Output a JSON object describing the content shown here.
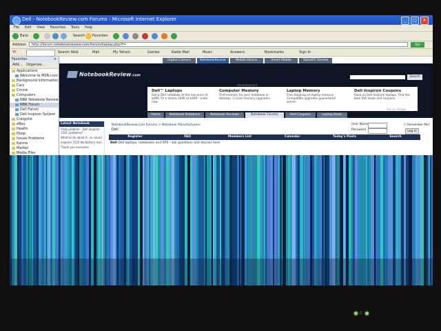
{
  "window": {
    "title": "Dell - NotebookReview.com Forums - Microsoft Internet Explorer",
    "buttons": [
      "_",
      "□",
      "×"
    ]
  },
  "menu": [
    "File",
    "Edit",
    "View",
    "Favorites",
    "Tools",
    "Help"
  ],
  "toolbar": {
    "back": "Back",
    "search": "Search",
    "favorites": "Favorites"
  },
  "address": {
    "label": "Address",
    "url": "http://forum.notebookreview.com/forumdisplay.php?f=",
    "go": "Go"
  },
  "links": [
    "Search Web",
    "Mail",
    "My Yahoo!",
    "Games",
    "Radio Mail",
    "Music",
    "Answers",
    "Bookmarks",
    "Sign In"
  ],
  "sidebar": {
    "title": "Favorites",
    "add": "Add...",
    "organize": "Organize...",
    "items": [
      {
        "label": "Applications",
        "type": "folder"
      },
      {
        "label": "Welcome to MSN.com - Windows",
        "type": "page"
      },
      {
        "label": "Background Information",
        "type": "folder"
      },
      {
        "label": "Cars",
        "type": "folder"
      },
      {
        "label": "Cmore",
        "type": "folder"
      },
      {
        "label": "Computers",
        "type": "folder"
      },
      {
        "label": "NBR Notebook Review Forums",
        "type": "page"
      },
      {
        "label": "NBR Forum",
        "type": "page"
      },
      {
        "label": "Dell Forum",
        "type": "page"
      },
      {
        "label": "Dell Inspiron System",
        "type": "page"
      },
      {
        "label": "Craigslist",
        "type": "folder"
      },
      {
        "label": "eBay",
        "type": "folder"
      },
      {
        "label": "Health",
        "type": "folder"
      },
      {
        "label": "Hoop",
        "type": "folder"
      },
      {
        "label": "Issues Problems",
        "type": "folder"
      },
      {
        "label": "Karma",
        "type": "folder"
      },
      {
        "label": "Market",
        "type": "folder"
      },
      {
        "label": "Media Files",
        "type": "folder"
      }
    ]
  },
  "site": {
    "top_tabs": [
      "Digital Camera Review",
      "NotebookReview",
      "Mobile Device Review",
      "Smart Mobile Reviews",
      "TabletPC Review"
    ],
    "logo": "NotebookReview",
    "logo_suffix": ".com",
    "search_button": "Search",
    "ad_label": "Advertisement",
    "ads": [
      {
        "title": "Dell™ Laptops",
        "desc": "Get a Dell notebook at the low price of $499. Or a Vostro 1400 at $699 - order now."
      },
      {
        "title": "Computer Memory",
        "desc": "Find memory for your notebook or desktop. Crucial memory upgrades."
      },
      {
        "title": "Laptop Memory",
        "desc": "Free shipping on laptop memory. Compatible upgrades guaranteed online."
      },
      {
        "title": "Dell Inspiron Coupons",
        "desc": "Save on Dell Inspiron laptops. Find the best Dell deals and coupons."
      }
    ],
    "ads_by": "Ads by Google",
    "nav": [
      "Home",
      "Notebook Database",
      "Notebook Reviews",
      "Notebook Forums",
      "Dell Coupons",
      "Laptop Deals"
    ],
    "nav_active": 3,
    "latest_title": "Latest Notebook Discussion",
    "latest_items": [
      "Vista problem - Dell Inspiron 1501 problems?",
      "What to do about it, no sound",
      "Inspiron 1520 No Battery Icon",
      "Thank you everyone"
    ],
    "breadcrumb": "NotebookReview.com Forums > Notebook Manufacturers",
    "forum_title": "Dell",
    "username_label": "User Name",
    "password_label": "Password",
    "remember_label": "Remember Me?",
    "login_button": "Log in",
    "forum_nav": [
      "Register",
      "FAQ",
      "Members List",
      "Calendar",
      "Today's Posts",
      "Search"
    ],
    "forum_desc_bold": "Dell",
    "forum_desc": "Dell laptops, notebooks and XPS - ask questions and discuss here"
  },
  "tray": {
    "indicator_icons": [
      "power-icon",
      "battery-icon"
    ]
  }
}
